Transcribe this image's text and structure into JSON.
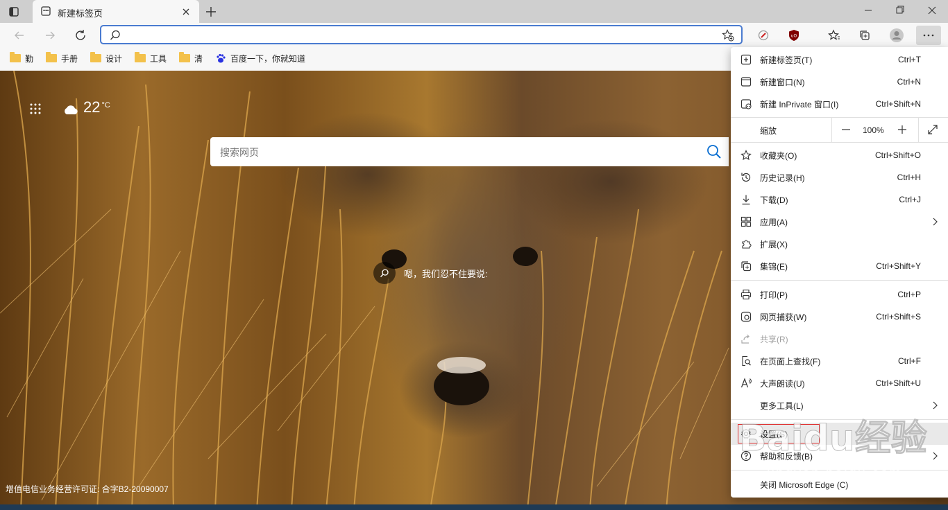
{
  "tab": {
    "title": "新建标签页"
  },
  "address": {
    "value": "",
    "placeholder": ""
  },
  "favorites": [
    {
      "label": "勤"
    },
    {
      "label": "手册"
    },
    {
      "label": "设计"
    },
    {
      "label": "工具"
    },
    {
      "label": "清"
    },
    {
      "label": "百度一下，你就知道"
    }
  ],
  "newtab": {
    "weather_temp": "22",
    "weather_unit": "°C",
    "search_placeholder": "搜索网页",
    "caption": "嗯，我们忍不住要说:",
    "license": "增值电信业务经营许可证: 合字B2-20090007"
  },
  "menu": {
    "items": [
      {
        "icon": "new-tab-icon",
        "label": "新建标签页(T)",
        "shortcut": "Ctrl+T"
      },
      {
        "icon": "new-window-icon",
        "label": "新建窗口(N)",
        "shortcut": "Ctrl+N"
      },
      {
        "icon": "inprivate-icon",
        "label": "新建 InPrivate 窗口(I)",
        "shortcut": "Ctrl+Shift+N"
      }
    ],
    "zoom": {
      "label": "缩放",
      "value": "100%"
    },
    "items2": [
      {
        "icon": "favorites-icon",
        "label": "收藏夹(O)",
        "shortcut": "Ctrl+Shift+O"
      },
      {
        "icon": "history-icon",
        "label": "历史记录(H)",
        "shortcut": "Ctrl+H"
      },
      {
        "icon": "download-icon",
        "label": "下载(D)",
        "shortcut": "Ctrl+J"
      },
      {
        "icon": "apps-icon",
        "label": "应用(A)",
        "shortcut": ""
      },
      {
        "icon": "extensions-icon",
        "label": "扩展(X)",
        "shortcut": ""
      },
      {
        "icon": "collections-icon",
        "label": "集锦(E)",
        "shortcut": "Ctrl+Shift+Y"
      }
    ],
    "items3": [
      {
        "icon": "print-icon",
        "label": "打印(P)",
        "shortcut": "Ctrl+P"
      },
      {
        "icon": "web-capture-icon",
        "label": "网页捕获(W)",
        "shortcut": "Ctrl+Shift+S"
      },
      {
        "icon": "share-icon",
        "label": "共享(R)",
        "shortcut": ""
      },
      {
        "icon": "find-icon",
        "label": "在页面上查找(F)",
        "shortcut": "Ctrl+F"
      },
      {
        "icon": "read-aloud-icon",
        "label": "大声朗读(U)",
        "shortcut": "Ctrl+Shift+U"
      },
      {
        "icon": "",
        "label": "更多工具(L)",
        "shortcut": ""
      }
    ],
    "items4": [
      {
        "icon": "settings-icon",
        "label": "设置(S)",
        "shortcut": ""
      },
      {
        "icon": "help-icon",
        "label": "帮助和反馈(B)",
        "shortcut": ""
      },
      {
        "icon": "",
        "label": "关闭 Microsoft Edge (C)",
        "shortcut": ""
      }
    ]
  },
  "watermark": "jingyan.baidu.com",
  "watermark_logo": "Baidu经验"
}
